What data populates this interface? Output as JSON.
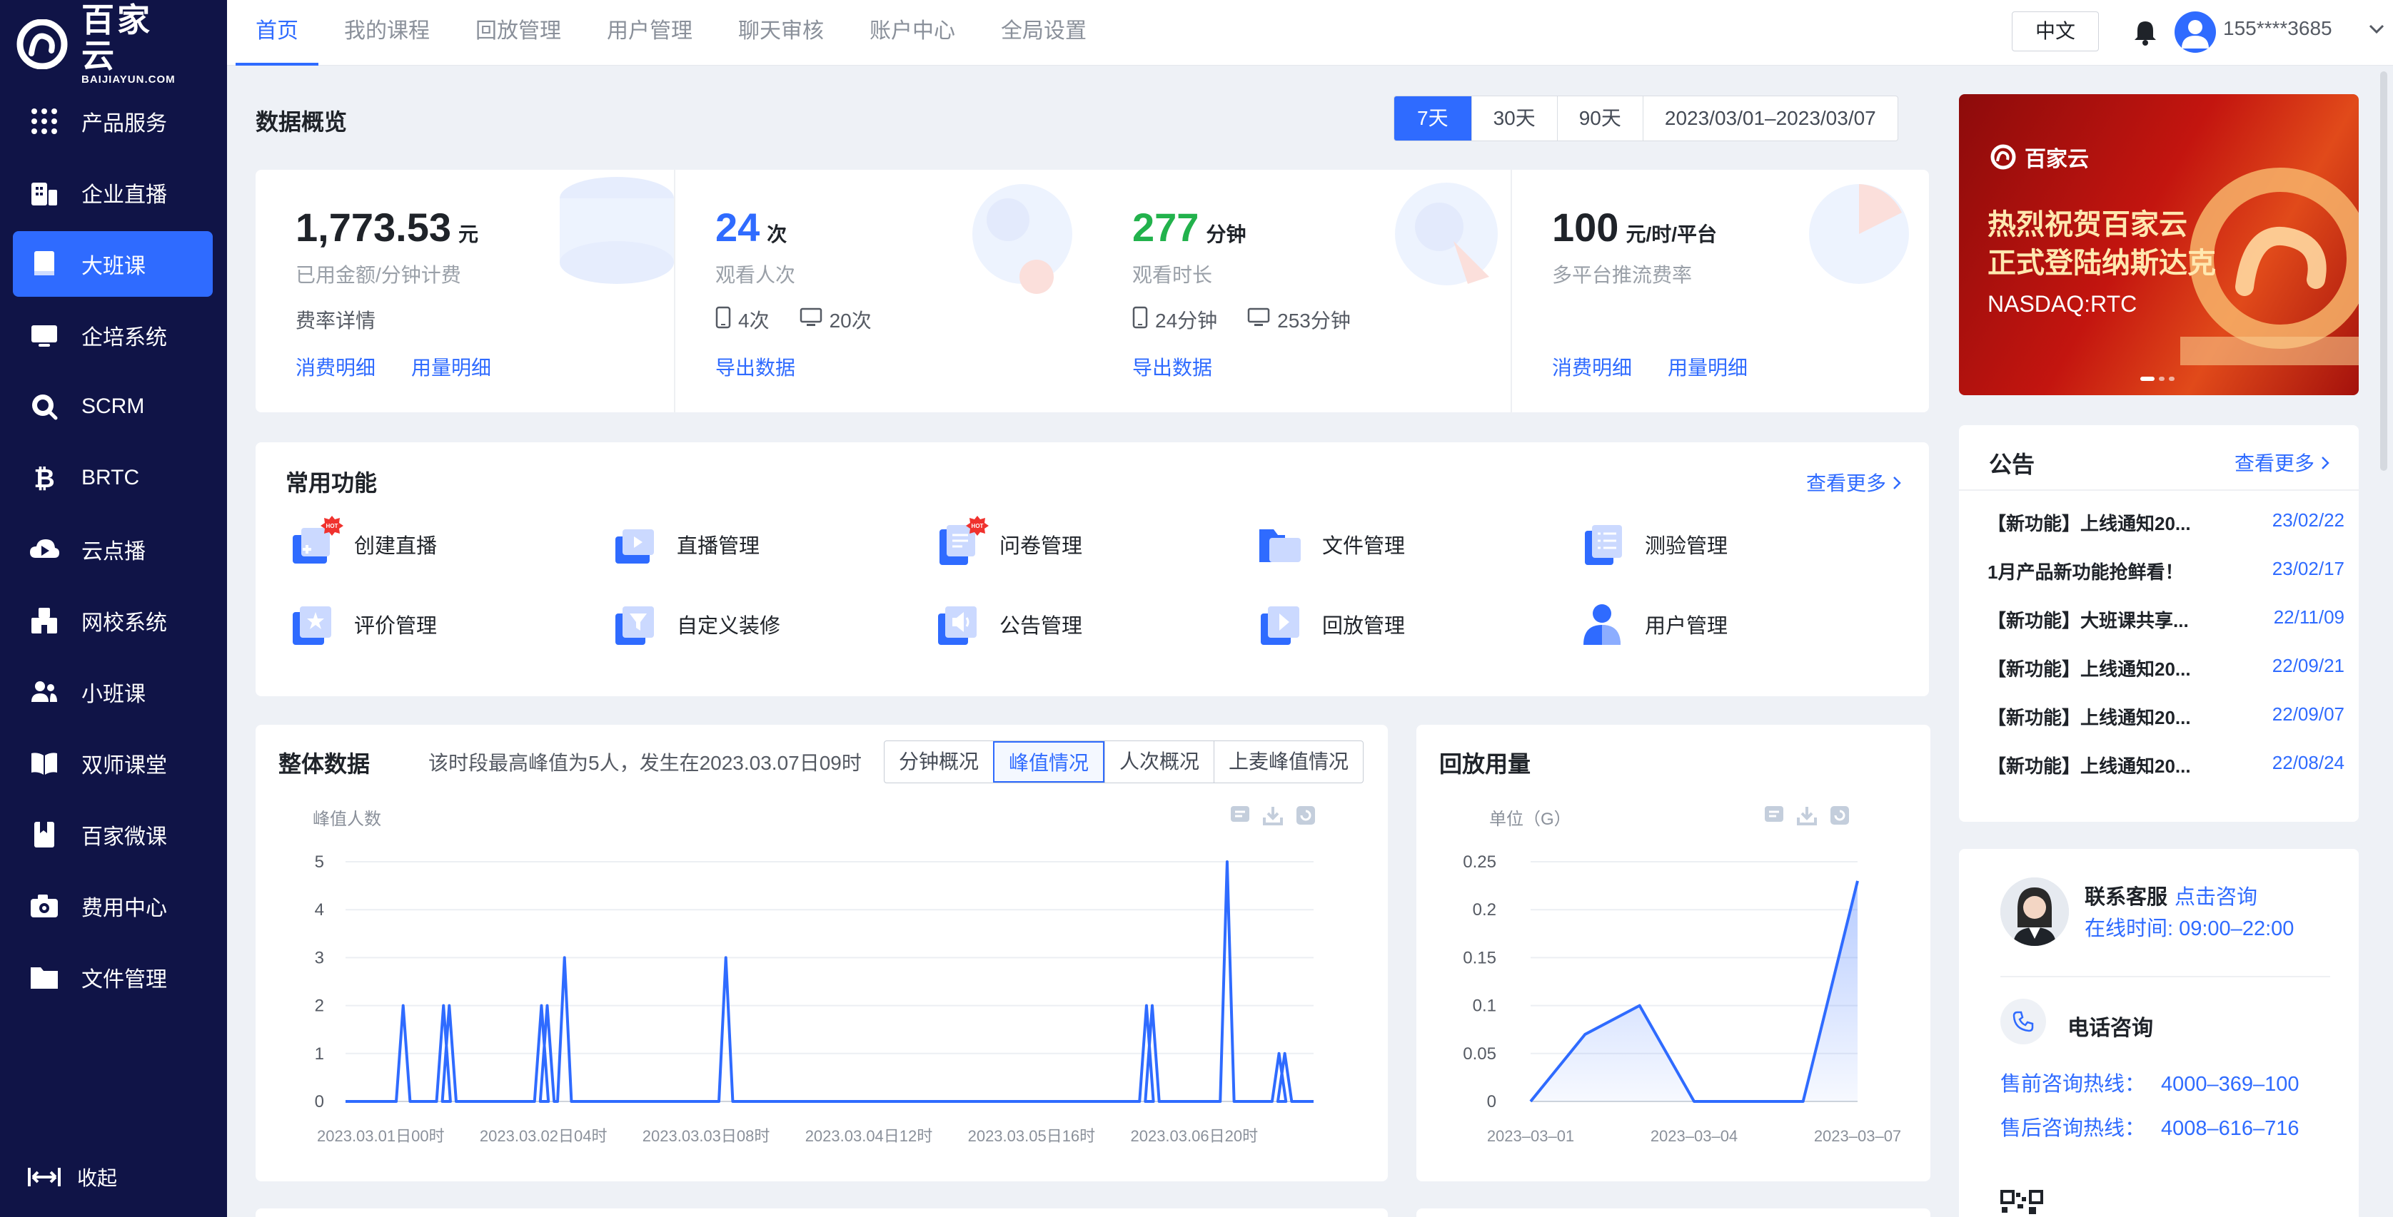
{
  "brand": {
    "name_cn": "百家云",
    "name_en": "BAIJIAYUN.COM"
  },
  "sidebar": {
    "items": [
      {
        "label": "产品服务",
        "icon": "grid-icon"
      },
      {
        "label": "企业直播",
        "icon": "building-icon"
      },
      {
        "label": "大班课",
        "icon": "book-icon"
      },
      {
        "label": "企培系统",
        "icon": "monitor-icon"
      },
      {
        "label": "SCRM",
        "icon": "chat-icon"
      },
      {
        "label": "BRTC",
        "icon": "bitcoin-icon"
      },
      {
        "label": "云点播",
        "icon": "cloud-play-icon"
      },
      {
        "label": "网校系统",
        "icon": "school-icon"
      },
      {
        "label": "小班课",
        "icon": "users-icon"
      },
      {
        "label": "双师课堂",
        "icon": "open-book-icon"
      },
      {
        "label": "百家微课",
        "icon": "bookmark-icon"
      },
      {
        "label": "费用中心",
        "icon": "camera-icon"
      },
      {
        "label": "文件管理",
        "icon": "folder-icon"
      }
    ],
    "active_index": 2,
    "collapse_label": "收起"
  },
  "topbar": {
    "tabs": [
      "首页",
      "我的课程",
      "回放管理",
      "用户管理",
      "聊天审核",
      "账户中心",
      "全局设置"
    ],
    "active_tab": 0,
    "language": "中文",
    "user": "155****3685"
  },
  "overview": {
    "title": "数据概览",
    "ranges": [
      "7天",
      "30天",
      "90天",
      "2023/03/01–2023/03/07"
    ],
    "selected_range": "7天",
    "stats": [
      {
        "value": "1,773.53",
        "unit": "元",
        "label": "已用金额/分钟计费",
        "link1": "费率详情",
        "links": [
          "消费明细",
          "用量明细"
        ],
        "color": "#1f2329"
      },
      {
        "value": "24",
        "unit": "次",
        "label": "观看人次",
        "mobile": "4次",
        "pc": "20次",
        "links": [
          "导出数据"
        ],
        "color": "#2f6bff"
      },
      {
        "value": "277",
        "unit": "分钟",
        "label": "观看时长",
        "mobile": "24分钟",
        "pc": "253分钟",
        "links": [
          "导出数据"
        ],
        "color": "#22b24c"
      },
      {
        "value": "100",
        "unit": "元/时/平台",
        "label": "多平台推流费率",
        "links": [
          "消费明细",
          "用量明细"
        ],
        "color": "#1f2329"
      }
    ]
  },
  "banner": {
    "logo": "百家云",
    "line1": "热烈祝贺百家云",
    "line2": "正式登陆纳斯达克",
    "line3": "NASDAQ:RTC"
  },
  "functions": {
    "title": "常用功能",
    "more": "查看更多",
    "items": [
      {
        "label": "创建直播",
        "hot": true
      },
      {
        "label": "直播管理",
        "hot": false
      },
      {
        "label": "问卷管理",
        "hot": true
      },
      {
        "label": "文件管理",
        "hot": false
      },
      {
        "label": "测验管理",
        "hot": false
      },
      {
        "label": "评价管理",
        "hot": false
      },
      {
        "label": "自定义装修",
        "hot": false
      },
      {
        "label": "公告管理",
        "hot": false
      },
      {
        "label": "回放管理",
        "hot": false
      },
      {
        "label": "用户管理",
        "hot": false
      }
    ],
    "hot_badge": "HOT"
  },
  "notice": {
    "title": "公告",
    "more": "查看更多",
    "items": [
      {
        "title": "【新功能】上线通知20...",
        "date": "23/02/22"
      },
      {
        "title": "1月产品新功能抢鲜看！",
        "date": "23/02/17"
      },
      {
        "title": "【新功能】大班课共享...",
        "date": "22/11/09"
      },
      {
        "title": "【新功能】上线通知20...",
        "date": "22/09/21"
      },
      {
        "title": "【新功能】上线通知20...",
        "date": "22/09/07"
      },
      {
        "title": "【新功能】上线通知20...",
        "date": "22/08/24"
      }
    ]
  },
  "contact": {
    "name": "联系客服",
    "link": "点击咨询",
    "hours": "在线时间: 09:00–22:00",
    "phone_title": "电话咨询",
    "presale_label": "售前咨询热线：",
    "presale_number": "4000–369–100",
    "aftersale_label": "售后咨询热线：",
    "aftersale_number": "4008–616–716"
  },
  "overall": {
    "title": "整体数据",
    "note": "该时段最高峰值为5人，发生在2023.03.07日09时",
    "modes": [
      "分钟概况",
      "峰值情况",
      "人次概况",
      "上麦峰值情况"
    ],
    "active_mode": 1
  },
  "replay": {
    "title": "回放用量"
  },
  "chart_data": [
    {
      "type": "line",
      "title": "",
      "ylabel": "峰值人数",
      "ylim": [
        0,
        5
      ],
      "yticks": [
        0,
        1,
        2,
        3,
        4,
        5
      ],
      "xticklabels": [
        "2023.03.01日00时",
        "2023.03.02日04时",
        "2023.03.03日08时",
        "2023.03.04日12时",
        "2023.03.05日16时",
        "2023.03.06日20时"
      ],
      "x_hours_total": 168,
      "peaks": [
        {
          "x": 10,
          "y": 2
        },
        {
          "x": 17,
          "y": 2
        },
        {
          "x": 18,
          "y": 2
        },
        {
          "x": 34,
          "y": 2
        },
        {
          "x": 35,
          "y": 2
        },
        {
          "x": 38,
          "y": 3
        },
        {
          "x": 66,
          "y": 3
        },
        {
          "x": 139,
          "y": 2
        },
        {
          "x": 140,
          "y": 2
        },
        {
          "x": 153,
          "y": 5
        },
        {
          "x": 162,
          "y": 1
        },
        {
          "x": 163,
          "y": 1
        }
      ],
      "color": "#2f6bff"
    },
    {
      "type": "area",
      "title": "",
      "ylabel": "单位（G）",
      "ylim": [
        0,
        0.25
      ],
      "yticks": [
        "0",
        "0.05",
        "0.1",
        "0.15",
        "0.2",
        "0.25"
      ],
      "xticklabels": [
        "2023–03–01",
        "2023–03–04",
        "2023–03–07"
      ],
      "x": [
        "2023–03–01",
        "2023–03–02",
        "2023–03–03",
        "2023–03–04",
        "2023–03–05",
        "2023–03–06",
        "2023–03–07"
      ],
      "values": [
        0,
        0.07,
        0.1,
        0,
        0,
        0,
        0.23
      ],
      "color": "#2f6bff"
    }
  ]
}
